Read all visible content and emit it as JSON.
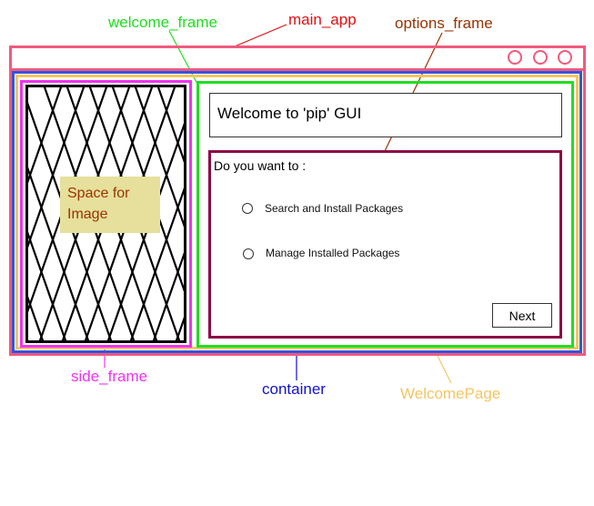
{
  "labels": {
    "welcome_frame": "welcome_frame",
    "main_app": "main_app",
    "options_frame": "options_frame",
    "side_frame": "side_frame",
    "container": "container",
    "welcome_page": "WelcomePage"
  },
  "window": {
    "buttons": [
      "circle-icon",
      "circle-icon",
      "circle-icon"
    ]
  },
  "image_placeholder": {
    "line1": "Space for",
    "line2": "Image"
  },
  "welcome_title": "Welcome to 'pip' GUI",
  "options": {
    "prompt": "Do you want to :",
    "choices": [
      {
        "label": "Search and Install Packages"
      },
      {
        "label": "Manage Installed Packages"
      }
    ],
    "next_label": "Next"
  },
  "colors": {
    "main_app": "#f05a7e",
    "container": "#3355dd",
    "welcome_page": "#f5c563",
    "side_frame": "#ee33ee",
    "welcome_frame": "#22dd22",
    "options_frame": "#8b0a45",
    "label_main_app": "#e01010",
    "label_options": "#993300",
    "label_welcome": "#22dd22",
    "label_side": "#ee33ee",
    "label_container": "#1111cc",
    "label_welcome_page": "#f5c563"
  }
}
